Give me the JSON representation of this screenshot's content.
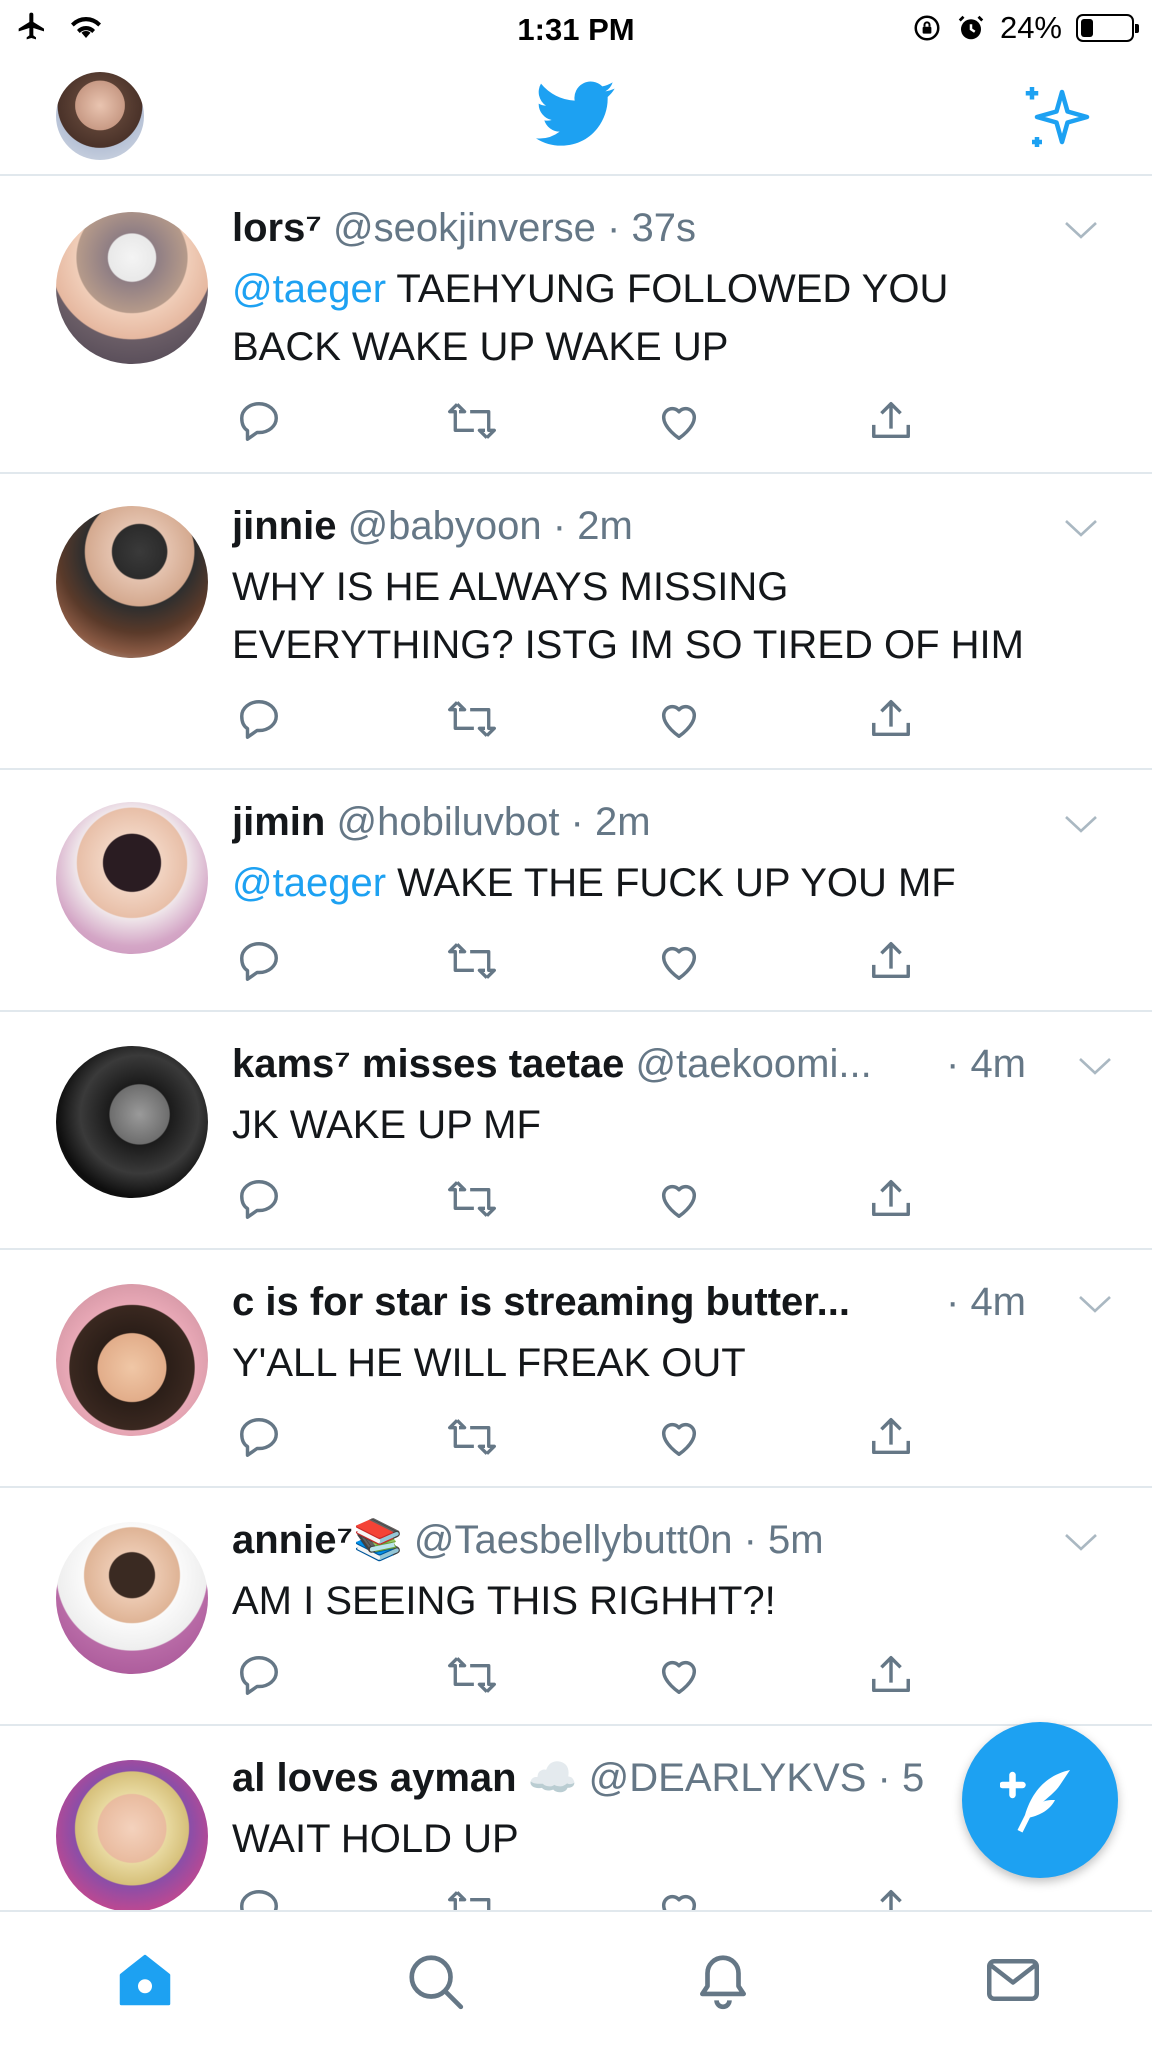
{
  "status_bar": {
    "time": "1:31 PM",
    "battery_percent": "24%",
    "battery_level": 0.24
  },
  "colors": {
    "accent": "#1da1f2",
    "text": "#14171a",
    "secondary": "#657786",
    "divider": "#e1e8ed"
  },
  "nav": {
    "left": "profile-avatar",
    "center": "twitter-bird-icon",
    "right": "sparkle-icon"
  },
  "tweets": [
    {
      "name": "lors⁷",
      "handle": "@seokjinverse",
      "time": "37s",
      "mention": "@taeger",
      "text_line1": " TAEHYUNG FOLLOWED YOU",
      "text_line2": "BACK WAKE UP WAKE UP"
    },
    {
      "name": "jinnie",
      "handle": "@babyoon",
      "time": "2m",
      "mention": "",
      "text_line1": "WHY IS HE ALWAYS MISSING",
      "text_line2": "EVERYTHING? ISTG IM SO TIRED OF HIM"
    },
    {
      "name": "jimin",
      "handle": "@hobiluvbot",
      "time": "2m",
      "mention": "@taeger",
      "text_line1": " WAKE THE FUCK UP YOU MF",
      "text_line2": ""
    },
    {
      "name": "kams⁷ misses taetae",
      "handle": "@taekoomi...",
      "time": "4m",
      "mention": "",
      "text_line1": "JK WAKE UP MF",
      "text_line2": ""
    },
    {
      "name": "c is for star is streaming butter...",
      "handle": "",
      "time": "4m",
      "mention": "",
      "text_line1": "Y'ALL HE WILL FREAK OUT",
      "text_line2": ""
    },
    {
      "name": "annie⁷📚",
      "handle": "@Taesbellybutt0n",
      "time": "5m",
      "mention": "",
      "text_line1": "AM I SEEING THIS RIGHHT?!",
      "text_line2": ""
    },
    {
      "name": "al loves ayman ☁️",
      "handle": "@DEARLYKVS",
      "time": "5",
      "mention": "",
      "text_line1": "WAIT HOLD UP",
      "text_line2": ""
    }
  ],
  "tabbar": [
    "home-icon",
    "search-icon",
    "notifications-icon",
    "messages-icon"
  ]
}
